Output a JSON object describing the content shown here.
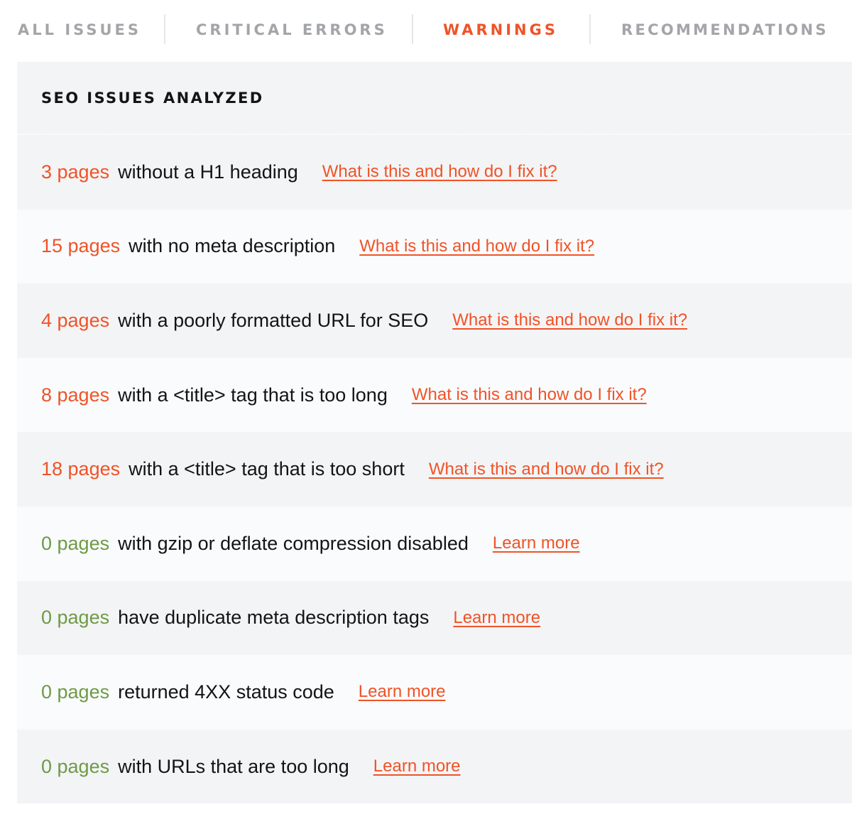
{
  "tabs": [
    {
      "label": "ALL ISSUES",
      "active": false
    },
    {
      "label": "CRITICAL ERRORS",
      "active": false
    },
    {
      "label": "WARNINGS",
      "active": true
    },
    {
      "label": "RECOMMENDATIONS",
      "active": false
    }
  ],
  "panel": {
    "title": "SEO ISSUES ANALYZED",
    "rows": [
      {
        "count": "3 pages",
        "status": "bad",
        "text": "without a H1 heading",
        "link": "What is this and how do I fix it?"
      },
      {
        "count": "15 pages",
        "status": "bad",
        "text": "with no meta description",
        "link": "What is this and how do I fix it?"
      },
      {
        "count": "4 pages",
        "status": "bad",
        "text": "with a poorly formatted URL for SEO",
        "link": "What is this and how do I fix it?"
      },
      {
        "count": "8 pages",
        "status": "bad",
        "text": "with a <title> tag that is too long",
        "link": "What is this and how do I fix it?"
      },
      {
        "count": "18 pages",
        "status": "bad",
        "text": "with a <title> tag that is too short",
        "link": "What is this and how do I fix it?"
      },
      {
        "count": "0 pages",
        "status": "good",
        "text": "with gzip or deflate compression disabled",
        "link": "Learn more"
      },
      {
        "count": "0 pages",
        "status": "good",
        "text": "have duplicate meta description tags",
        "link": "Learn more"
      },
      {
        "count": "0 pages",
        "status": "good",
        "text": "returned 4XX status code",
        "link": "Learn more"
      },
      {
        "count": "0 pages",
        "status": "good",
        "text": "with URLs that are too long",
        "link": "Learn more"
      }
    ]
  },
  "colors": {
    "accent": "#f05327",
    "good": "#6e9a45",
    "tab_inactive": "#a3a5a9"
  }
}
